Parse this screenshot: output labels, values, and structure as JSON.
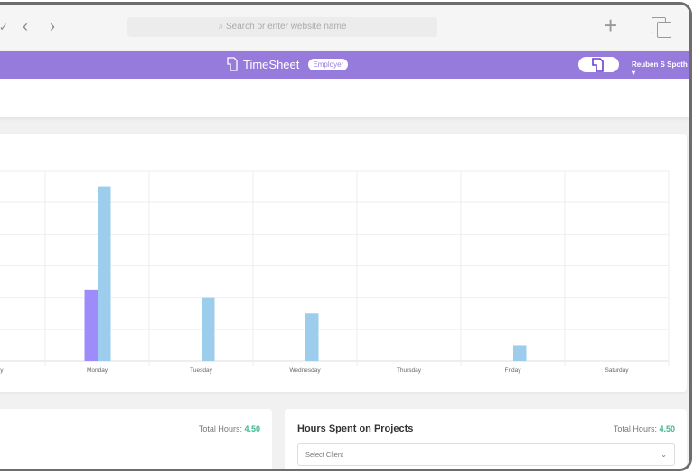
{
  "browser": {
    "search_placeholder": "Search or enter website name",
    "back": "‹",
    "forward": "›",
    "plus": "+"
  },
  "header": {
    "app_name": "TimeSheet",
    "role_badge": "Employer",
    "user_name": "Reuben S Spoth",
    "accent": "#977bdc"
  },
  "chart_data": {
    "type": "bar",
    "categories": [
      "Sunday",
      "Monday",
      "Tuesday",
      "Wednesday",
      "Thursday",
      "Friday",
      "Saturday"
    ],
    "series": [
      {
        "color": "#9f8cfb",
        "values": [
          0,
          2.25,
          0,
          0,
          0,
          0,
          0
        ]
      },
      {
        "color": "#9ccdec",
        "values": [
          0,
          5.5,
          2,
          1.5,
          0,
          0.5,
          0
        ]
      }
    ],
    "ylim": [
      0,
      6
    ],
    "grid": true,
    "xlabel": "",
    "ylabel": ""
  },
  "left_card": {
    "total_label": "Total Hours:",
    "total_value": "4.50"
  },
  "projects_card": {
    "title": "Hours Spent on Projects",
    "total_label": "Total Hours:",
    "total_value": "4.50",
    "select_placeholder": "Select Client"
  }
}
